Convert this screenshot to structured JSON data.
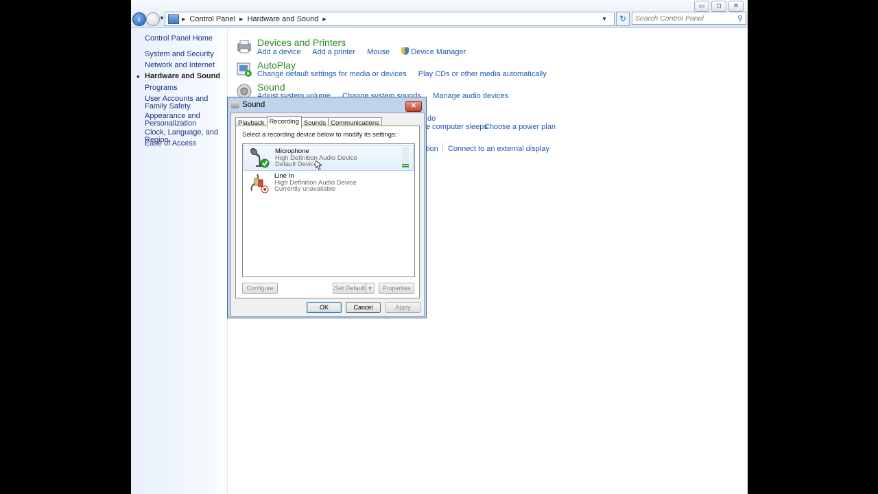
{
  "window": {
    "caption_buttons": [
      "▭",
      "◻",
      "✕"
    ],
    "address": {
      "segments": [
        "Control Panel",
        "Hardware and Sound"
      ]
    },
    "search_placeholder": "Search Control Panel"
  },
  "leftnav": {
    "items": [
      {
        "label": "Control Panel Home"
      },
      {
        "label": "System and Security"
      },
      {
        "label": "Network and Internet"
      },
      {
        "label": "Hardware and Sound",
        "current": true
      },
      {
        "label": "Programs"
      },
      {
        "label": "User Accounts and Family Safety"
      },
      {
        "label": "Appearance and Personalization"
      },
      {
        "label": "Clock, Language, and Region"
      },
      {
        "label": "Ease of Access"
      }
    ]
  },
  "categories": [
    {
      "title": "Devices and Printers",
      "icon": "printer-icon",
      "links": [
        "Add a device",
        "Add a printer",
        "Mouse",
        "Device Manager"
      ]
    },
    {
      "title": "AutoPlay",
      "icon": "autoplay-icon",
      "links": [
        "Change default settings for media or devices",
        "Play CDs or other media automatically"
      ]
    },
    {
      "title": "Sound",
      "icon": "speaker-icon",
      "links": [
        "Adjust system volume",
        "Change system sounds",
        "Manage audio devices"
      ]
    }
  ],
  "partial_links": {
    "row1": "do",
    "row2a": "e computer sleeps",
    "row2b": "Choose a power plan",
    "row3a": "tion",
    "row3b": "Connect to an external display"
  },
  "sound_dialog": {
    "title": "Sound",
    "tabs": [
      "Playback",
      "Recording",
      "Sounds",
      "Communications"
    ],
    "active_tab": "Recording",
    "instruction": "Select a recording device below to modify its settings:",
    "devices": [
      {
        "name": "Microphone",
        "driver": "High Definition Audio Device",
        "status": "Default Device",
        "icon": "microphone-icon",
        "badge": "green-check-icon",
        "level_fraction": 0.2
      },
      {
        "name": "Line In",
        "driver": "High Definition Audio Device",
        "status": "Currently unavailable",
        "icon": "line-in-cable-icon",
        "badge": "red-down-arrow-icon"
      }
    ],
    "buttons": {
      "configure": "Configure",
      "set_default": "Set Default",
      "properties": "Properties",
      "ok": "OK",
      "cancel": "Cancel",
      "apply": "Apply"
    }
  }
}
